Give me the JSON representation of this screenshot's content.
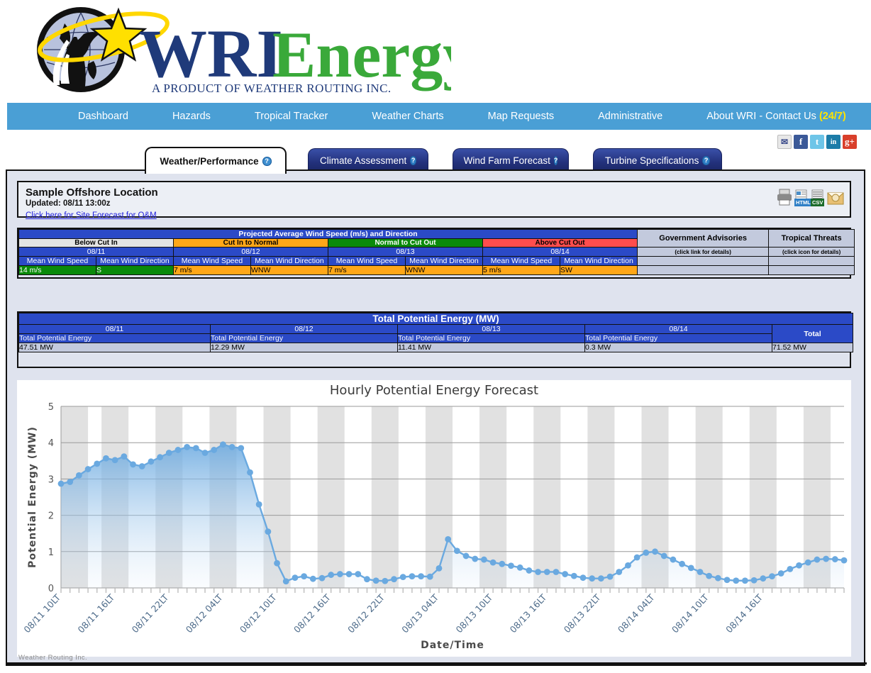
{
  "brand": {
    "name_part1": "WRI",
    "name_part2": "Energy",
    "tagline": "A PRODUCT OF WEATHER ROUTING INC.",
    "colors": {
      "navy": "#1f3a7a",
      "green": "#3aa93a",
      "star": "#ffd700",
      "navbar": "#4a9fd5"
    }
  },
  "nav": {
    "items": [
      {
        "label": "Dashboard"
      },
      {
        "label": "Hazards"
      },
      {
        "label": "Tropical Tracker"
      },
      {
        "label": "Weather Charts"
      },
      {
        "label": "Map Requests"
      },
      {
        "label": "Administrative"
      }
    ],
    "about_label": "About WRI - Contact Us",
    "about_badge": "(24/7)"
  },
  "social": [
    {
      "name": "email-icon",
      "glyph": "✉"
    },
    {
      "name": "facebook-icon",
      "glyph": "f"
    },
    {
      "name": "twitter-icon",
      "glyph": "t"
    },
    {
      "name": "linkedin-icon",
      "glyph": "in"
    },
    {
      "name": "googleplus-icon",
      "glyph": "g+"
    }
  ],
  "tabs": [
    {
      "label": "Weather/Performance",
      "active": true
    },
    {
      "label": "Climate Assessment",
      "active": false
    },
    {
      "label": "Wind Farm Forecast",
      "active": false
    },
    {
      "label": "Turbine Specifications",
      "active": false
    }
  ],
  "location": {
    "title": "Sample Offshore Location",
    "updated": "Updated: 08/11 13:00z",
    "link": "Click here for Site Forecast for O&M",
    "export": {
      "print": "print-icon",
      "html": "HTML",
      "csv": "CSV",
      "email": "email-export-icon"
    }
  },
  "wind_table": {
    "title": "Projected Average Wind Speed (m/s) and Direction",
    "legend": [
      {
        "label": "Below Cut In",
        "color": "#e4e4e4"
      },
      {
        "label": "Cut In to Normal",
        "color": "#ffa718"
      },
      {
        "label": "Normal to Cut Out",
        "color": "#0a8a0a"
      },
      {
        "label": "Above Cut Out",
        "color": "#ff4d4d"
      }
    ],
    "sub_headers": [
      "Mean Wind Speed",
      "Mean Wind Direction"
    ],
    "days": [
      {
        "date": "08/11",
        "speed": "14 m/s",
        "direction": "S",
        "status": "normal"
      },
      {
        "date": "08/12",
        "speed": "7 m/s",
        "direction": "WNW",
        "status": "cutin"
      },
      {
        "date": "08/13",
        "speed": "7 m/s",
        "direction": "WNW",
        "status": "cutin"
      },
      {
        "date": "08/14",
        "speed": "5 m/s",
        "direction": "SW",
        "status": "cutin"
      }
    ],
    "advisories": {
      "header": "Government Advisories",
      "sub": "(click link for details)"
    },
    "tropical": {
      "header": "Tropical Threats",
      "sub": "(click icon for details)"
    }
  },
  "energy_table": {
    "title": "Total Potential Energy (MW)",
    "row_label": "Total Potential Energy",
    "total_label": "Total",
    "days": [
      {
        "date": "08/11",
        "value": "47.51 MW"
      },
      {
        "date": "08/12",
        "value": "12.29 MW"
      },
      {
        "date": "08/13",
        "value": "11.41 MW"
      },
      {
        "date": "08/14",
        "value": "0.3 MW"
      }
    ],
    "total_value": "71.52 MW"
  },
  "footer": {
    "text": "Weather Routing Inc."
  },
  "chart_data": {
    "type": "area",
    "title": "Hourly Potential Energy Forecast",
    "xlabel": "Date/Time",
    "ylabel": "Potential Energy (MW)",
    "ylim": [
      0,
      5
    ],
    "yticks": [
      0,
      1,
      2,
      3,
      4,
      5
    ],
    "grid": true,
    "legend_position": "none",
    "series_color": "#6aa9e0",
    "tick_labels": [
      "08/11 10LT",
      "08/11 16LT",
      "08/11 22LT",
      "08/12 04LT",
      "08/12 10LT",
      "08/12 16LT",
      "08/12 22LT",
      "08/13 04LT",
      "08/13 10LT",
      "08/13 16LT",
      "08/13 22LT",
      "08/14 04LT",
      "08/14 10LT",
      "08/14 16LT"
    ],
    "tick_label_every": 6,
    "x": [
      "08/11 10LT",
      "08/11 11LT",
      "08/11 12LT",
      "08/11 13LT",
      "08/11 14LT",
      "08/11 15LT",
      "08/11 16LT",
      "08/11 17LT",
      "08/11 18LT",
      "08/11 19LT",
      "08/11 20LT",
      "08/11 21LT",
      "08/11 22LT",
      "08/11 23LT",
      "08/12 00LT",
      "08/12 01LT",
      "08/12 02LT",
      "08/12 03LT",
      "08/12 04LT",
      "08/12 05LT",
      "08/12 06LT",
      "08/12 07LT",
      "08/12 08LT",
      "08/12 09LT",
      "08/12 10LT",
      "08/12 11LT",
      "08/12 12LT",
      "08/12 13LT",
      "08/12 14LT",
      "08/12 15LT",
      "08/12 16LT",
      "08/12 17LT",
      "08/12 18LT",
      "08/12 19LT",
      "08/12 20LT",
      "08/12 21LT",
      "08/12 22LT",
      "08/12 23LT",
      "08/13 00LT",
      "08/13 01LT",
      "08/13 02LT",
      "08/13 03LT",
      "08/13 04LT",
      "08/13 05LT",
      "08/13 06LT",
      "08/13 07LT",
      "08/13 08LT",
      "08/13 09LT",
      "08/13 10LT",
      "08/13 11LT",
      "08/13 12LT",
      "08/13 13LT",
      "08/13 14LT",
      "08/13 15LT",
      "08/13 16LT",
      "08/13 17LT",
      "08/13 18LT",
      "08/13 19LT",
      "08/13 20LT",
      "08/13 21LT",
      "08/13 22LT",
      "08/13 23LT",
      "08/14 00LT",
      "08/14 01LT",
      "08/14 02LT",
      "08/14 03LT",
      "08/14 04LT",
      "08/14 05LT",
      "08/14 06LT",
      "08/14 07LT",
      "08/14 08LT",
      "08/14 09LT",
      "08/14 10LT",
      "08/14 11LT",
      "08/14 12LT",
      "08/14 13LT",
      "08/14 14LT",
      "08/14 15LT",
      "08/14 16LT",
      "08/14 17LT"
    ],
    "values": [
      2.87,
      2.92,
      3.1,
      3.27,
      3.42,
      3.57,
      3.52,
      3.62,
      3.4,
      3.35,
      3.48,
      3.6,
      3.72,
      3.8,
      3.88,
      3.85,
      3.72,
      3.8,
      3.95,
      3.88,
      3.85,
      3.18,
      2.3,
      1.55,
      0.68,
      0.18,
      0.28,
      0.32,
      0.25,
      0.27,
      0.36,
      0.38,
      0.38,
      0.38,
      0.24,
      0.2,
      0.19,
      0.24,
      0.3,
      0.32,
      0.32,
      0.31,
      0.54,
      1.34,
      1.02,
      0.88,
      0.8,
      0.78,
      0.7,
      0.66,
      0.61,
      0.56,
      0.48,
      0.44,
      0.44,
      0.44,
      0.38,
      0.33,
      0.28,
      0.26,
      0.26,
      0.31,
      0.44,
      0.62,
      0.84,
      0.97,
      1.0,
      0.88,
      0.78,
      0.66,
      0.55,
      0.44,
      0.33,
      0.27,
      0.22,
      0.2,
      0.2,
      0.21,
      0.26,
      0.32
    ],
    "values_tail": [
      0.4,
      0.52,
      0.62,
      0.7,
      0.78,
      0.8,
      0.79,
      0.76
    ]
  }
}
